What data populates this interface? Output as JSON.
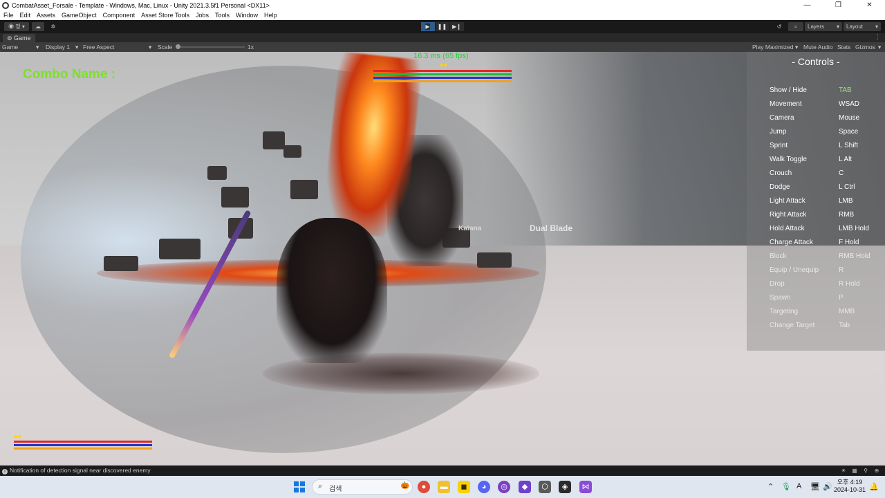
{
  "window": {
    "title": "CombatAsset_Forsale - Template - Windows, Mac, Linux - Unity 2021.3.5f1 Personal <DX11>",
    "controls": [
      "—",
      "❐",
      "✕"
    ]
  },
  "menu": [
    "File",
    "Edit",
    "Assets",
    "GameObject",
    "Component",
    "Asset Store Tools",
    "Jobs",
    "Tools",
    "Window",
    "Help"
  ],
  "toolbar": {
    "account_label": "정",
    "play_icon": "play-icon",
    "pause_icon": "pause-icon",
    "step_icon": "step-icon",
    "layers_label": "Layers",
    "layout_label": "Layout"
  },
  "game_tab": {
    "label": "Game",
    "view_select": "Game",
    "display_select": "Display 1",
    "aspect_select": "Free Aspect",
    "scale_label": "Scale",
    "scale_value": "1x",
    "play_maximized": "Play Maximized",
    "mute_audio": "Mute Audio",
    "stats": "Stats",
    "gizmos": "Gizmos"
  },
  "hud": {
    "fps": "16.3 ms (65 fps)",
    "combo_name": "Combo Name :",
    "boss_stars": "◆◆",
    "player_stars": "◆◆",
    "weapon_katana": "Katana",
    "weapon_dual_blade": "Dual Blade"
  },
  "controls_panel": {
    "heading": "- Controls -",
    "rows": [
      {
        "action": "Show / Hide",
        "key": "TAB"
      },
      {
        "action": "Movement",
        "key": "WSAD"
      },
      {
        "action": "Camera",
        "key": "Mouse"
      },
      {
        "action": "Jump",
        "key": "Space"
      },
      {
        "action": "Sprint",
        "key": "L Shift"
      },
      {
        "action": "Walk Toggle",
        "key": "L Alt"
      },
      {
        "action": "Crouch",
        "key": "C"
      },
      {
        "action": "Dodge",
        "key": "L Ctrl"
      },
      {
        "action": "Light Attack",
        "key": "LMB"
      },
      {
        "action": "Right Attack",
        "key": "RMB"
      },
      {
        "action": "Hold Attack",
        "key": "LMB Hold"
      },
      {
        "action": "Charge Attack",
        "key": "F Hold"
      },
      {
        "action": "Block",
        "key": "RMB Hold"
      },
      {
        "action": "Equip / Unequip",
        "key": "R"
      },
      {
        "action": "Drop",
        "key": "R Hold"
      },
      {
        "action": "Spawn",
        "key": "P"
      },
      {
        "action": "Targeting",
        "key": "MMB"
      },
      {
        "action": "Change Target",
        "key": "Tab"
      }
    ],
    "highlight_color": "#9be27a"
  },
  "status": {
    "message": "Notification of detection signal near discovered enemy"
  },
  "taskbar": {
    "search_label": "검색",
    "clock_time": "오후 4:19",
    "clock_date": "2024-10-31",
    "ime_label": "A"
  },
  "colors": {
    "hp_red": "#e3261f",
    "stamina_green": "#27b63a",
    "mana_blue": "#2338c9",
    "rage_orange": "#f2a21a",
    "fps_green": "#27d23a",
    "combo_green": "#7de02a",
    "play_active": "#2f5c8a"
  }
}
